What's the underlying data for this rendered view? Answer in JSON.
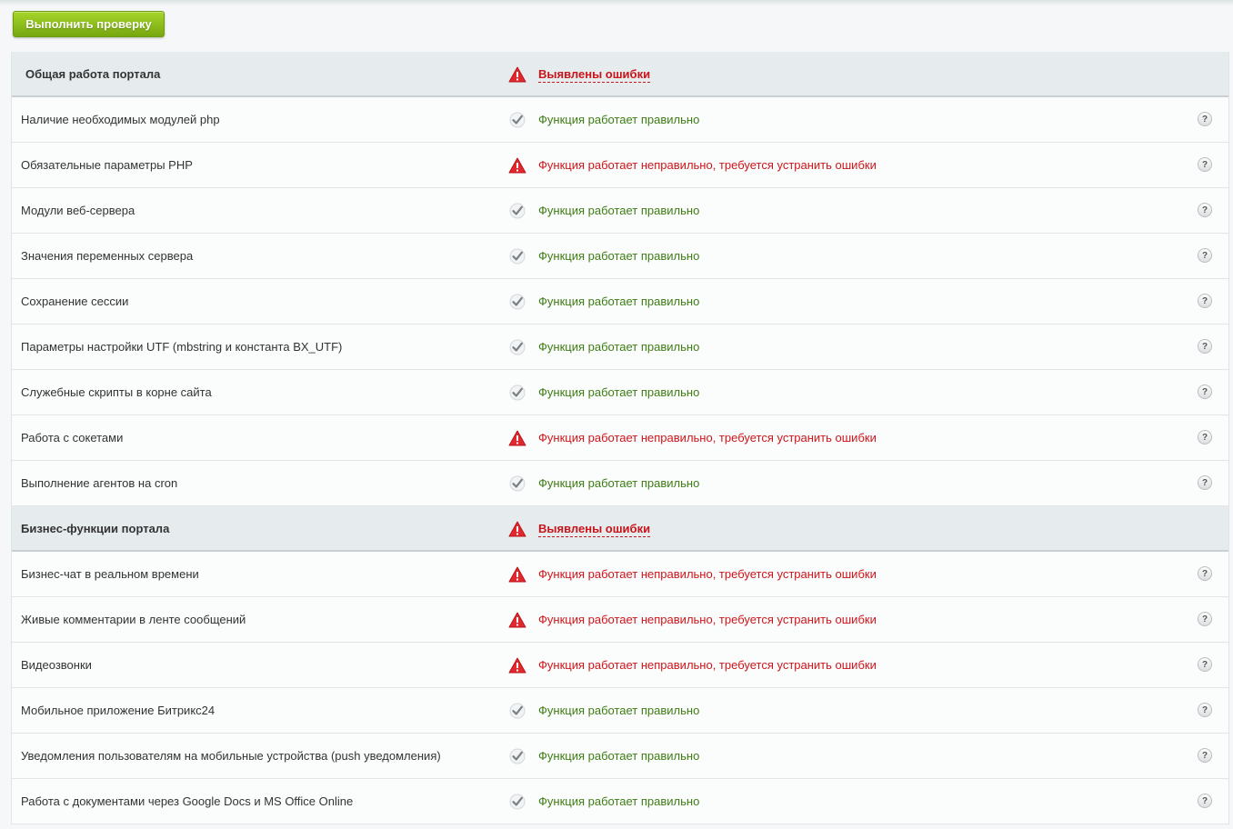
{
  "toolbar": {
    "run_label": "Выполнить проверку"
  },
  "sections": [
    {
      "title": "Общая работа портала",
      "status": "Выявлены ошибки",
      "rows": [
        {
          "name": "Наличие необходимых модулей php",
          "ok": true,
          "status": "Функция работает правильно"
        },
        {
          "name": "Обязательные параметры PHP",
          "ok": false,
          "status": "Функция работает неправильно, требуется устранить ошибки"
        },
        {
          "name": "Модули веб-сервера",
          "ok": true,
          "status": "Функция работает правильно"
        },
        {
          "name": "Значения переменных сервера",
          "ok": true,
          "status": "Функция работает правильно"
        },
        {
          "name": "Сохранение сессии",
          "ok": true,
          "status": "Функция работает правильно"
        },
        {
          "name": "Параметры настройки UTF (mbstring и константа BX_UTF)",
          "ok": true,
          "status": "Функция работает правильно"
        },
        {
          "name": "Служебные скрипты в корне сайта",
          "ok": true,
          "status": "Функция работает правильно"
        },
        {
          "name": "Работа с сокетами",
          "ok": false,
          "status": "Функция работает неправильно, требуется устранить ошибки"
        },
        {
          "name": "Выполнение агентов на cron",
          "ok": true,
          "status": "Функция работает правильно"
        }
      ]
    },
    {
      "title": "Бизнес-функции портала",
      "status": "Выявлены ошибки",
      "rows": [
        {
          "name": "Бизнес-чат в реальном времени",
          "ok": false,
          "status": "Функция работает неправильно, требуется устранить ошибки"
        },
        {
          "name": "Живые комментарии в ленте сообщений",
          "ok": false,
          "status": "Функция работает неправильно, требуется устранить ошибки"
        },
        {
          "name": "Видеозвонки",
          "ok": false,
          "status": "Функция работает неправильно, требуется устранить ошибки"
        },
        {
          "name": "Мобильное приложение Битрикс24",
          "ok": true,
          "status": "Функция работает правильно"
        },
        {
          "name": "Уведомления пользователям на мобильные устройства (push уведомления)",
          "ok": true,
          "status": "Функция работает правильно"
        },
        {
          "name": "Работа с документами через Google Docs и MS Office Online",
          "ok": true,
          "status": "Функция работает правильно"
        }
      ]
    }
  ],
  "help_label": "?",
  "colors": {
    "ok": "#3e7d14",
    "error": "#d0151a",
    "button": "#8cbf1e"
  },
  "icons": {
    "ok": "check-icon",
    "error": "warning-icon",
    "help": "help-icon"
  }
}
